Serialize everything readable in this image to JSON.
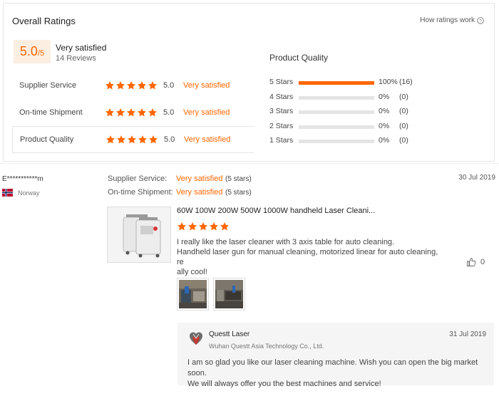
{
  "overall": {
    "title": "Overall Ratings",
    "how_link": "How ratings work",
    "score": "5.0",
    "score_max": "/5",
    "verdict": "Very satisfied",
    "reviews": "14 Reviews"
  },
  "categories": [
    {
      "label": "Supplier Service",
      "stars": 5,
      "score": "5.0",
      "verdict": "Very satisfied"
    },
    {
      "label": "On-time Shipment",
      "stars": 5,
      "score": "5.0",
      "verdict": "Very satisfied"
    },
    {
      "label": "Product Quality",
      "stars": 5,
      "score": "5.0",
      "verdict": "Very satisfied"
    }
  ],
  "product_quality": {
    "title": "Product Quality",
    "rows": [
      {
        "label": "5 Stars",
        "fraction": 1.0,
        "percent": "100%",
        "count": "(16)"
      },
      {
        "label": "4 Stars",
        "fraction": 0,
        "percent": "0%",
        "count": "(0)"
      },
      {
        "label": "3 Stars",
        "fraction": 0,
        "percent": "0%",
        "count": "(0)"
      },
      {
        "label": "2 Stars",
        "fraction": 0,
        "percent": "0%",
        "count": "(0)"
      },
      {
        "label": "1 Stars",
        "fraction": 0,
        "percent": "0%",
        "count": "(0)"
      }
    ]
  },
  "review": {
    "reviewer": "E***********m",
    "country": "Norway",
    "date": "30 Jul 2019",
    "supplier_label": "Supplier Service:",
    "supplier_value": "Very satisfied",
    "supplier_stars": "(5 stars)",
    "shipment_label": "On-time Shipment:",
    "shipment_value": "Very satisfied",
    "shipment_stars": "(5 stars)",
    "product_title": "60W 100W 200W 500W 1000W handheld Laser Cleani...",
    "product_stars": 5,
    "text_line1": "I really like the laser cleaner with 3 axis table for auto cleaning.",
    "text_line2": "Handheld laser gun for manual cleaning, motorized linear for auto cleaning, re",
    "text_line3": "ally cool!",
    "likes": "0"
  },
  "reply": {
    "company": "Questt Laser",
    "subtitle": "Wuhan Questt Asia Technology Co., Ltd.",
    "date": "31 Jul 2019",
    "line1": "I am so glad you like our laser cleaning machine. Wish you can open the big market soon.",
    "line2": "We will always offer you the best machines and service!"
  },
  "colors": {
    "accent": "#ff6600",
    "accent_bg": "#fdeee2"
  }
}
